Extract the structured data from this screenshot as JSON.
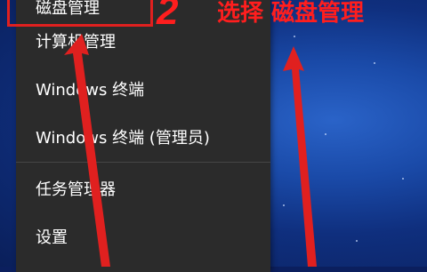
{
  "context_menu": {
    "items": [
      {
        "label": "磁盘管理"
      },
      {
        "label": "计算机管理"
      },
      {
        "label": "Windows 终端"
      },
      {
        "label": "Windows 终端 (管理员)"
      },
      {
        "label": "任务管理器"
      },
      {
        "label": "设置"
      }
    ]
  },
  "annotation": {
    "step_number": "2",
    "instruction": "选择 磁盘管理",
    "color": "#ff1e1e"
  }
}
